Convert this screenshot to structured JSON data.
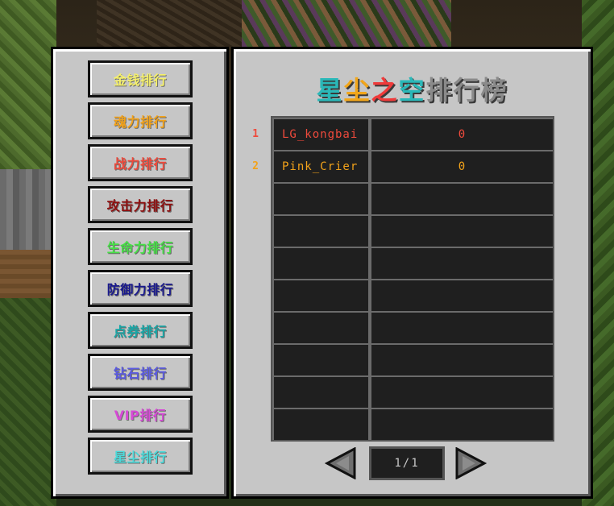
{
  "sidebar": {
    "buttons": [
      {
        "label": "金钱排行",
        "color": "#f5f06a"
      },
      {
        "label": "魂力排行",
        "color": "#f2a21a"
      },
      {
        "label": "战力排行",
        "color": "#ef4a3c"
      },
      {
        "label": "攻击力排行",
        "color": "#8e1010"
      },
      {
        "label": "生命力排行",
        "color": "#46e046"
      },
      {
        "label": "防御力排行",
        "color": "#1a1a8e"
      },
      {
        "label": "点券排行",
        "color": "#17a6a6"
      },
      {
        "label": "钻石排行",
        "color": "#5a5ae0"
      },
      {
        "label": "VIP排行",
        "color": "#d64ad6"
      },
      {
        "label": "星尘排行",
        "color": "#4adada"
      }
    ]
  },
  "title": {
    "parts": [
      {
        "text": "星",
        "color": "#2ab8b8"
      },
      {
        "text": "尘",
        "color": "#f2a61a"
      },
      {
        "text": "之",
        "color": "#ef3a3a"
      },
      {
        "text": "空",
        "color": "#2ab8b8"
      },
      {
        "text": "排行榜",
        "color": "#8a8a8a"
      }
    ]
  },
  "leaderboard": {
    "rows": [
      {
        "rank": "1",
        "rank_color": "#ef4a3c",
        "name": "LG_kongbai",
        "score": "0",
        "color": "#ef4a3c"
      },
      {
        "rank": "2",
        "rank_color": "#f2a21a",
        "name": "Pink_Crier",
        "score": "0",
        "color": "#f2a21a"
      },
      {
        "rank": "",
        "name": "",
        "score": "",
        "color": "#ffffff"
      },
      {
        "rank": "",
        "name": "",
        "score": "",
        "color": "#ffffff"
      },
      {
        "rank": "",
        "name": "",
        "score": "",
        "color": "#ffffff"
      },
      {
        "rank": "",
        "name": "",
        "score": "",
        "color": "#ffffff"
      },
      {
        "rank": "",
        "name": "",
        "score": "",
        "color": "#ffffff"
      },
      {
        "rank": "",
        "name": "",
        "score": "",
        "color": "#ffffff"
      },
      {
        "rank": "",
        "name": "",
        "score": "",
        "color": "#ffffff"
      },
      {
        "rank": "",
        "name": "",
        "score": "",
        "color": "#ffffff"
      }
    ]
  },
  "pager": {
    "page_text": "1/1",
    "prev_icon": "triangle-left-icon",
    "next_icon": "triangle-right-icon"
  }
}
